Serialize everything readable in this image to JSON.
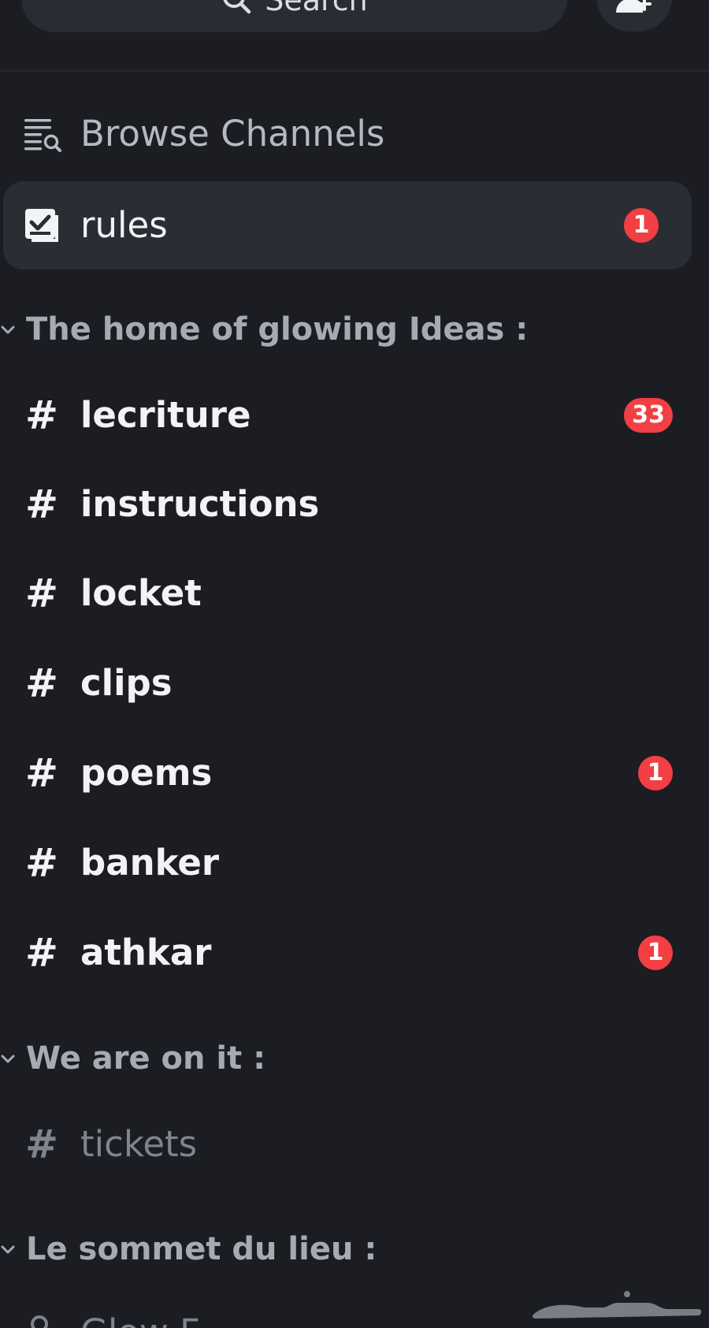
{
  "search": {
    "label": "Search"
  },
  "browse": {
    "label": "Browse Channels",
    "icon": "browse-channels-icon"
  },
  "rules": {
    "label": "rules",
    "badge": "1",
    "icon": "rules-checkbox-icon"
  },
  "categories": [
    {
      "label": "The home of glowing Ideas :",
      "channels": [
        {
          "label": "lecriture",
          "badge": "33"
        },
        {
          "label": "instructions",
          "badge": ""
        },
        {
          "label": "locket",
          "badge": ""
        },
        {
          "label": "clips",
          "badge": ""
        },
        {
          "label": "poems",
          "badge": "1"
        },
        {
          "label": "banker",
          "badge": ""
        },
        {
          "label": "athkar",
          "badge": "1"
        }
      ]
    },
    {
      "label": "We are on it  :",
      "channels": [
        {
          "label": "tickets",
          "badge": ""
        }
      ]
    },
    {
      "label": "Le sommet du lieu :",
      "channels": [
        {
          "label": "Glow F...",
          "badge": ""
        }
      ]
    }
  ],
  "hash_symbol": "#",
  "watermark": {
    "text": "حراج"
  },
  "colors": {
    "background": "#1c1d22",
    "selected_row": "#2b2d35",
    "badge": "#f23f43",
    "text_bright": "#f2f3f5",
    "text_muted": "#80848e",
    "category": "#a6abb3"
  }
}
